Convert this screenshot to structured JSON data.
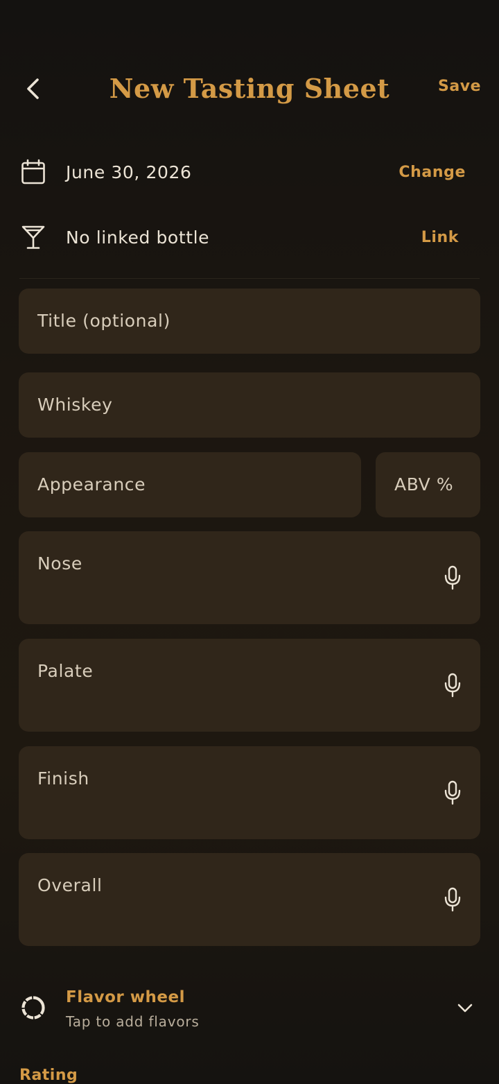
{
  "header": {
    "title": "New Tasting Sheet",
    "save_label": "Save",
    "back_icon": "chevron-left-icon"
  },
  "date_row": {
    "icon": "calendar-icon",
    "value": "June 30, 2026",
    "action_label": "Change"
  },
  "bottle_row": {
    "icon": "cocktail-glass-icon",
    "value": "No linked bottle",
    "action_label": "Link"
  },
  "fields": {
    "title": {
      "placeholder": "Title (optional)"
    },
    "whiskey": {
      "placeholder": "Whiskey"
    },
    "appearance": {
      "placeholder": "Appearance"
    },
    "abv": {
      "placeholder": "ABV %"
    },
    "nose": {
      "placeholder": "Nose",
      "icon": "microphone-icon"
    },
    "palate": {
      "placeholder": "Palate",
      "icon": "microphone-icon"
    },
    "finish": {
      "placeholder": "Finish",
      "icon": "microphone-icon"
    },
    "overall": {
      "placeholder": "Overall",
      "icon": "microphone-icon"
    }
  },
  "flavor_wheel": {
    "icon": "flavor-wheel-icon",
    "title": "Flavor wheel",
    "subtitle": "Tap to add flavors",
    "chevron_icon": "chevron-down-icon"
  },
  "rating": {
    "label": "Rating"
  },
  "colors": {
    "accent": "#d49a46",
    "background": "#1b1610",
    "field_background": "#30261a",
    "text_primary": "#ece4d6"
  }
}
